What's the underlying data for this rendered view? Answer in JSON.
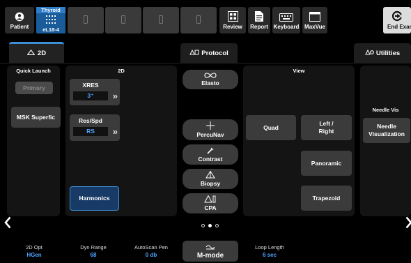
{
  "topbar": {
    "patient_label": "Patient",
    "probe_exam": "Thyroid",
    "probe_name": "eL18-4",
    "review_label": "Review",
    "report_label": "Report",
    "keyboard_label": "Keyboard",
    "maxvue_label": "MaxVue",
    "end_exam_label": "End Exam"
  },
  "tabs": {
    "mode_2d": "2D",
    "protocol": "Protocol",
    "utilities": "Utilities"
  },
  "quick_launch": {
    "title": "Quick Launch",
    "primary": "Primary",
    "msk": "MSK Superfic"
  },
  "panel_2d": {
    "title": "2D",
    "xres_label": "XRES",
    "xres_value": "3⁺",
    "resspd_label": "Res/Spd",
    "resspd_value": "RS",
    "harmonics": "Harmonics"
  },
  "middle": {
    "elasto": "Elasto",
    "percunav": "PercuNav",
    "contrast": "Contrast",
    "biopsy": "Biopsy",
    "cpa": "CPA"
  },
  "view": {
    "title": "View",
    "quad": "Quad",
    "left_right": "Left / Right",
    "panoramic": "Panoramic",
    "trapezoid": "Trapezoid"
  },
  "needle": {
    "title": "Needle Vis",
    "button": "Needle Visualization"
  },
  "bottom": {
    "opt_label": "2D Opt",
    "opt_value": "HGen",
    "dyn_label": "Dyn Range",
    "dyn_value": "68",
    "pen_label": "AutoScan Pen",
    "pen_value": "0 db",
    "mmode": "M-mode",
    "loop_label": "Loop Length",
    "loop_value": "6 sec"
  },
  "colors": {
    "accent": "#3d8fd6",
    "value_blue": "#4fa3ff",
    "panel": "#141414",
    "button": "#3b3b3b"
  }
}
